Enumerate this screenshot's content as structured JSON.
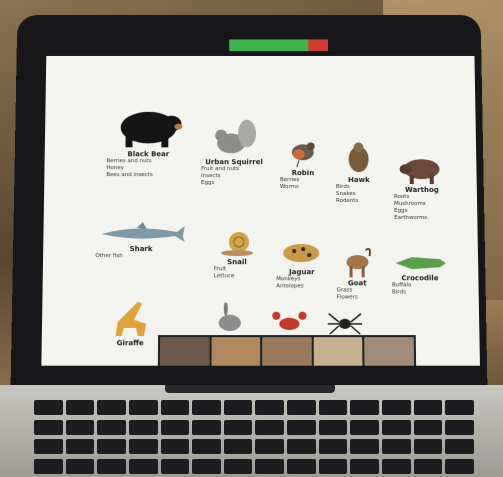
{
  "colors": {
    "bezel": "#17171a",
    "screen_bg": "#f3f3f0",
    "zoom_green": "#3fb34f",
    "zoom_red": "#d33a34"
  },
  "animals": [
    {
      "name": "Black Bear",
      "diet": [
        "Berries and nuts",
        "Honey",
        "Bees and insects"
      ],
      "icon": "bear-icon"
    },
    {
      "name": "Urban Squirrel",
      "diet": [
        "Fruit and nuts",
        "Insects",
        "Eggs"
      ],
      "icon": "squirrel-icon"
    },
    {
      "name": "Robin",
      "diet": [
        "Berries",
        "Worms"
      ],
      "icon": "robin-icon"
    },
    {
      "name": "Hawk",
      "diet": [
        "Birds",
        "Snakes",
        "Rodents"
      ],
      "icon": "hawk-icon"
    },
    {
      "name": "Warthog",
      "diet": [
        "Roots",
        "Mushrooms",
        "Eggs",
        "Earthworms"
      ],
      "icon": "warthog-icon"
    },
    {
      "name": "Shark",
      "diet": [
        "Other fish"
      ],
      "icon": "shark-icon"
    },
    {
      "name": "Snail",
      "diet": [
        "Fruit",
        "Lettuce"
      ],
      "icon": "snail-icon"
    },
    {
      "name": "Jaguar",
      "diet": [
        "Monkeys",
        "Antelopes"
      ],
      "icon": "jaguar-icon"
    },
    {
      "name": "Goat",
      "diet": [
        "Grass",
        "Flowers"
      ],
      "icon": "goat-icon"
    },
    {
      "name": "Crocodile",
      "diet": [
        "Buffalo",
        "Birds"
      ],
      "icon": "crocodile-icon"
    },
    {
      "name": "Giraffe",
      "diet": [],
      "icon": "giraffe-icon"
    },
    {
      "name": "",
      "diet": [],
      "icon": "rabbit-icon"
    },
    {
      "name": "",
      "diet": [],
      "icon": "crab-icon"
    },
    {
      "name": "",
      "diet": [],
      "icon": "spider-icon"
    }
  ]
}
